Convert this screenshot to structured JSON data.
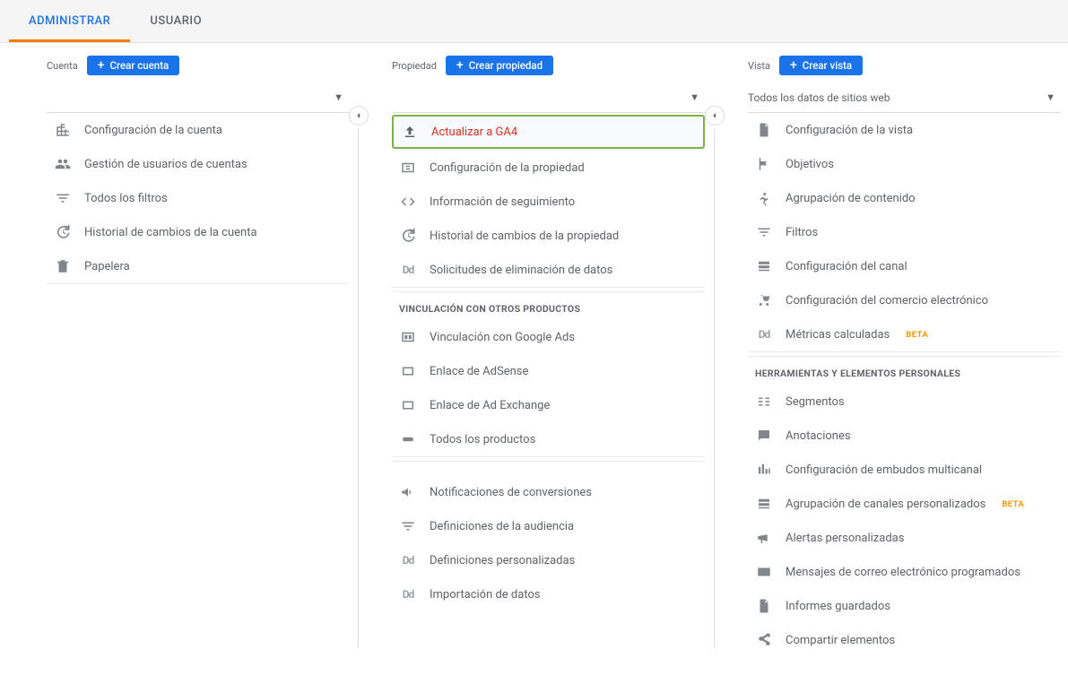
{
  "tabs": {
    "admin": "ADMINISTRAR",
    "user": "USUARIO"
  },
  "account": {
    "title": "Cuenta",
    "create_btn": "Crear cuenta",
    "items": [
      {
        "icon": "office",
        "label": "Configuración de la cuenta"
      },
      {
        "icon": "people",
        "label": "Gestión de usuarios de cuentas"
      },
      {
        "icon": "filter",
        "label": "Todos los filtros"
      },
      {
        "icon": "history",
        "label": "Historial de cambios de la cuenta"
      },
      {
        "icon": "trash",
        "label": "Papelera"
      }
    ]
  },
  "property": {
    "title": "Propiedad",
    "create_btn": "Crear propiedad",
    "items": [
      {
        "icon": "upload",
        "label": "Actualizar a GA4",
        "highlight": true
      },
      {
        "icon": "settings-box",
        "label": "Configuración de la propiedad"
      },
      {
        "icon": "code",
        "label": "Información de seguimiento"
      },
      {
        "icon": "history",
        "label": "Historial de cambios de la propiedad"
      },
      {
        "icon": "dd",
        "label": "Solicitudes de eliminación de datos"
      }
    ],
    "section1_title": "VINCULACIÓN CON OTROS PRODUCTOS",
    "section1": [
      {
        "icon": "ads",
        "label": "Vinculación con Google Ads"
      },
      {
        "icon": "box",
        "label": "Enlace de AdSense"
      },
      {
        "icon": "box",
        "label": "Enlace de Ad Exchange"
      },
      {
        "icon": "link",
        "label": "Todos los productos"
      }
    ],
    "section2": [
      {
        "icon": "megaphone",
        "label": "Notificaciones de conversiones"
      },
      {
        "icon": "filter",
        "label": "Definiciones de la audiencia"
      },
      {
        "icon": "dd",
        "label": "Definiciones personalizadas"
      },
      {
        "icon": "dd",
        "label": "Importación de datos"
      }
    ]
  },
  "view": {
    "title": "Vista",
    "create_btn": "Crear vista",
    "selector": "Todos los datos de sitios web",
    "items": [
      {
        "icon": "doc",
        "label": "Configuración de la vista"
      },
      {
        "icon": "flag",
        "label": "Objetivos"
      },
      {
        "icon": "person-run",
        "label": "Agrupación de contenido"
      },
      {
        "icon": "filter",
        "label": "Filtros"
      },
      {
        "icon": "channels",
        "label": "Configuración del canal"
      },
      {
        "icon": "cart",
        "label": "Configuración del comercio electrónico"
      },
      {
        "icon": "dd",
        "label": "Métricas calculadas",
        "beta": "BETA"
      }
    ],
    "section1_title": "HERRAMIENTAS Y ELEMENTOS PERSONALES",
    "section1": [
      {
        "icon": "segments",
        "label": "Segmentos"
      },
      {
        "icon": "comment",
        "label": "Anotaciones"
      },
      {
        "icon": "bars",
        "label": "Configuración de embudos multicanal"
      },
      {
        "icon": "channels",
        "label": "Agrupación de canales personalizados",
        "beta": "BETA"
      },
      {
        "icon": "bullhorn",
        "label": "Alertas personalizadas"
      },
      {
        "icon": "mail",
        "label": "Mensajes de correo electrónico programados"
      },
      {
        "icon": "doc",
        "label": "Informes guardados"
      },
      {
        "icon": "share",
        "label": "Compartir elementos"
      }
    ]
  }
}
